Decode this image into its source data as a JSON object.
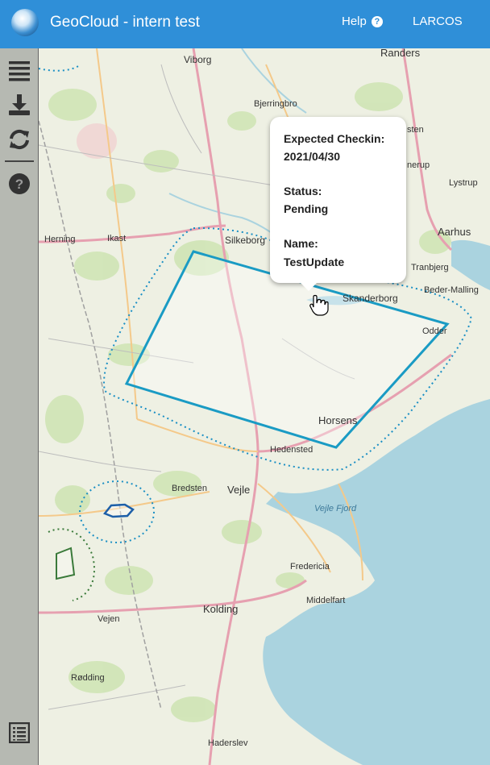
{
  "header": {
    "title": "GeoCloud - intern test",
    "help_label": "Help",
    "help_icon": "?",
    "user_label": "LARCOS"
  },
  "sidebar": {
    "items": [
      {
        "name": "layers-menu-icon"
      },
      {
        "name": "download-icon"
      },
      {
        "name": "refresh-icon"
      },
      {
        "name": "help-icon"
      },
      {
        "name": "list-panel-icon"
      }
    ]
  },
  "popup": {
    "expected_checkin_label": "Expected Checkin:",
    "expected_checkin_value": "2021/04/30",
    "status_label": "Status:",
    "status_value": "Pending",
    "name_label": "Name:",
    "name_value": "TestUpdate"
  },
  "map": {
    "places": [
      "Viborg",
      "Randers",
      "Bjerringbro",
      "Silkeborg",
      "Herning",
      "Ikast",
      "Aarhus",
      "Tranbjerg",
      "Beder-Malling",
      "Skanderborg",
      "Odder",
      "Horsens",
      "Hedensted",
      "Bredsten",
      "Vejle",
      "Vejle Fjord",
      "Fredericia",
      "Middelfart",
      "Kolding",
      "Vejen",
      "Rødding",
      "Haderslev",
      "Lystrup",
      "sten",
      "nerup"
    ],
    "colors": {
      "selected_polygon": "#1a9bc4",
      "dotted_outline": "#1a8fc4",
      "small_polygon": "#1d5fa8",
      "green_polygon": "#3a7a3a",
      "water": "#aad3df",
      "road": "#e6a0b0"
    }
  }
}
